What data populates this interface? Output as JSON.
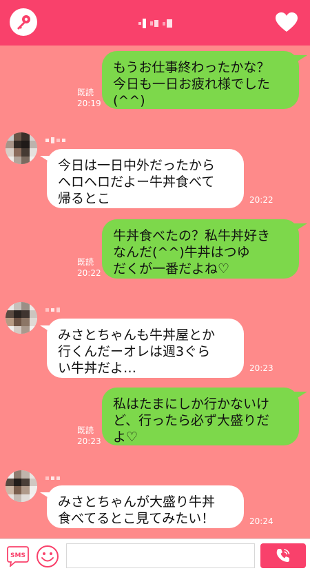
{
  "header": {
    "left_icon": "key-icon",
    "right_icon": "heart-icon",
    "title_obscured": true,
    "bg_color": "#f9416b"
  },
  "messages": [
    {
      "dir": "out",
      "text": "もうお仕事終わったかな？\n今日も一日お疲れ様でした\n(^^)",
      "read": "既読",
      "time": "20:19"
    },
    {
      "dir": "in",
      "text": "今日は一日中外だったから\nヘロヘロだよー牛丼食べて\n帰るとこ",
      "time": "20:22"
    },
    {
      "dir": "out",
      "text": "牛丼食べたの？私牛丼好き\nなんだ(^^)牛丼はつゆ\nだくが一番だよね♡",
      "read": "既読",
      "time": "20:22"
    },
    {
      "dir": "in",
      "text": "みさとちゃんも牛丼屋とか\n行くんだーオレは週3ぐら\nい牛丼だよ…",
      "time": "20:23"
    },
    {
      "dir": "out",
      "text": "私はたまにしか行かないけ\nど、行ったら必ず大盛りだ\nよ♡",
      "read": "既読",
      "time": "20:23"
    },
    {
      "dir": "in",
      "text": "みさとちゃんが大盛り牛丼\n食べてるとこ見てみたい！",
      "time": "20:24"
    }
  ],
  "footer": {
    "sms_label": "SMS",
    "input_placeholder": "",
    "call_icon": "phone-icon"
  },
  "colors": {
    "bg": "#fe8a8a",
    "out_bubble": "#7dd84b",
    "in_bubble": "#ffffff",
    "accent": "#f9416b"
  }
}
